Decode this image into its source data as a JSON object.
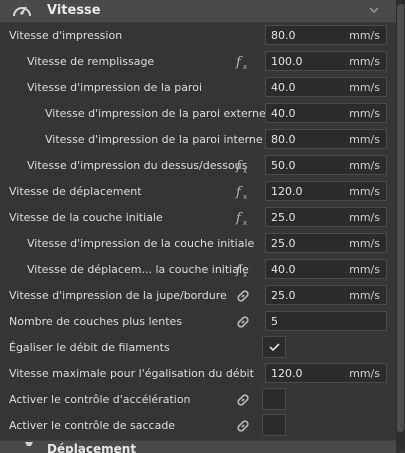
{
  "section": {
    "title": "Vitesse",
    "icon": "speedometer-icon",
    "collapse_icon": "chevron-down-icon"
  },
  "rows": [
    {
      "label": "Vitesse d'impression",
      "value": "80.0",
      "unit": "mm/s"
    },
    {
      "label": "Vitesse de remplissage",
      "icon": "function-icon",
      "value": "100.0",
      "unit": "mm/s"
    },
    {
      "label": "Vitesse d'impression de la paroi",
      "value": "40.0",
      "unit": "mm/s"
    },
    {
      "label": "Vitesse d'impression de la paroi externe",
      "value": "40.0",
      "unit": "mm/s"
    },
    {
      "label": "Vitesse d'impression de la paroi interne",
      "value": "80.0",
      "unit": "mm/s"
    },
    {
      "label": "Vitesse d'impression du dessus/dessous",
      "icon": "function-icon",
      "value": "50.0",
      "unit": "mm/s"
    },
    {
      "label": "Vitesse de déplacement",
      "icon": "function-icon",
      "value": "120.0",
      "unit": "mm/s"
    },
    {
      "label": "Vitesse de la couche initiale",
      "icon": "function-icon",
      "value": "25.0",
      "unit": "mm/s"
    },
    {
      "label": "Vitesse d'impression de la couche initiale",
      "value": "25.0",
      "unit": "mm/s"
    },
    {
      "label": "Vitesse de déplacem... la couche initiale",
      "icon": "function-icon",
      "value": "40.0",
      "unit": "mm/s"
    },
    {
      "label": "Vitesse d'impression de la jupe/bordure",
      "icon": "link-icon",
      "value": "25.0",
      "unit": "mm/s"
    },
    {
      "label": "Nombre de couches plus lentes",
      "icon": "link-icon",
      "value": "5",
      "unit": ""
    },
    {
      "label": "Égaliser le débit de filaments",
      "checked": true
    },
    {
      "label": "Vitesse maximale pour l'égalisation du débit",
      "value": "120.0",
      "unit": "mm/s"
    },
    {
      "label": "Activer le contrôle d'accélération",
      "icon": "link-icon",
      "checked": false
    },
    {
      "label": "Activer le contrôle de saccade",
      "icon": "link-icon",
      "checked": false
    }
  ],
  "next_section": {
    "title": "Déplacement",
    "icon": "travel-icon"
  }
}
